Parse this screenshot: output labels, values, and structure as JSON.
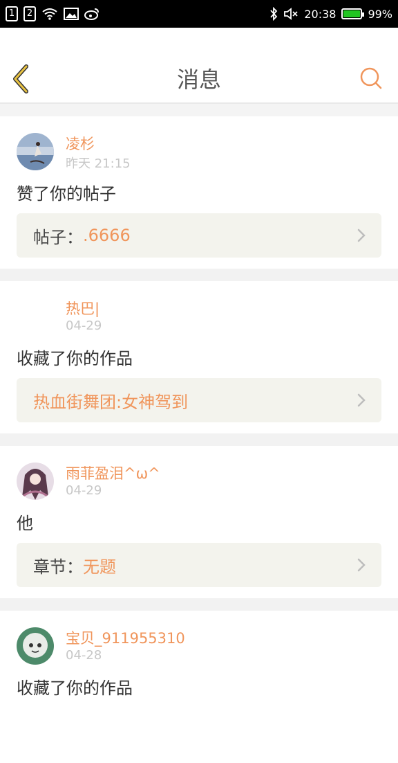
{
  "statusbar": {
    "sim1": "1",
    "sim2": "2",
    "time": "20:38",
    "battery": "99%"
  },
  "header": {
    "title": "消息",
    "back_icon": "chevron-left-icon",
    "search_icon": "search-icon",
    "accent": "#f0955b"
  },
  "messages": [
    {
      "user": "凌杉",
      "time": "昨天 21:15",
      "action": "赞了你的帖子",
      "ref_label": "帖子：",
      "ref_value": ".6666"
    },
    {
      "user": "热巴|",
      "time": "04-29",
      "action": "收藏了你的作品",
      "ref_label": "",
      "ref_value": "热血街舞团:女神驾到"
    },
    {
      "user": "雨菲盈泪^ω^",
      "time": "04-29",
      "action": "他",
      "ref_label": "章节：",
      "ref_value": "无题"
    },
    {
      "user": "宝贝_911955310",
      "time": "04-28",
      "action": "收藏了你的作品",
      "ref_label": "",
      "ref_value": ""
    }
  ]
}
